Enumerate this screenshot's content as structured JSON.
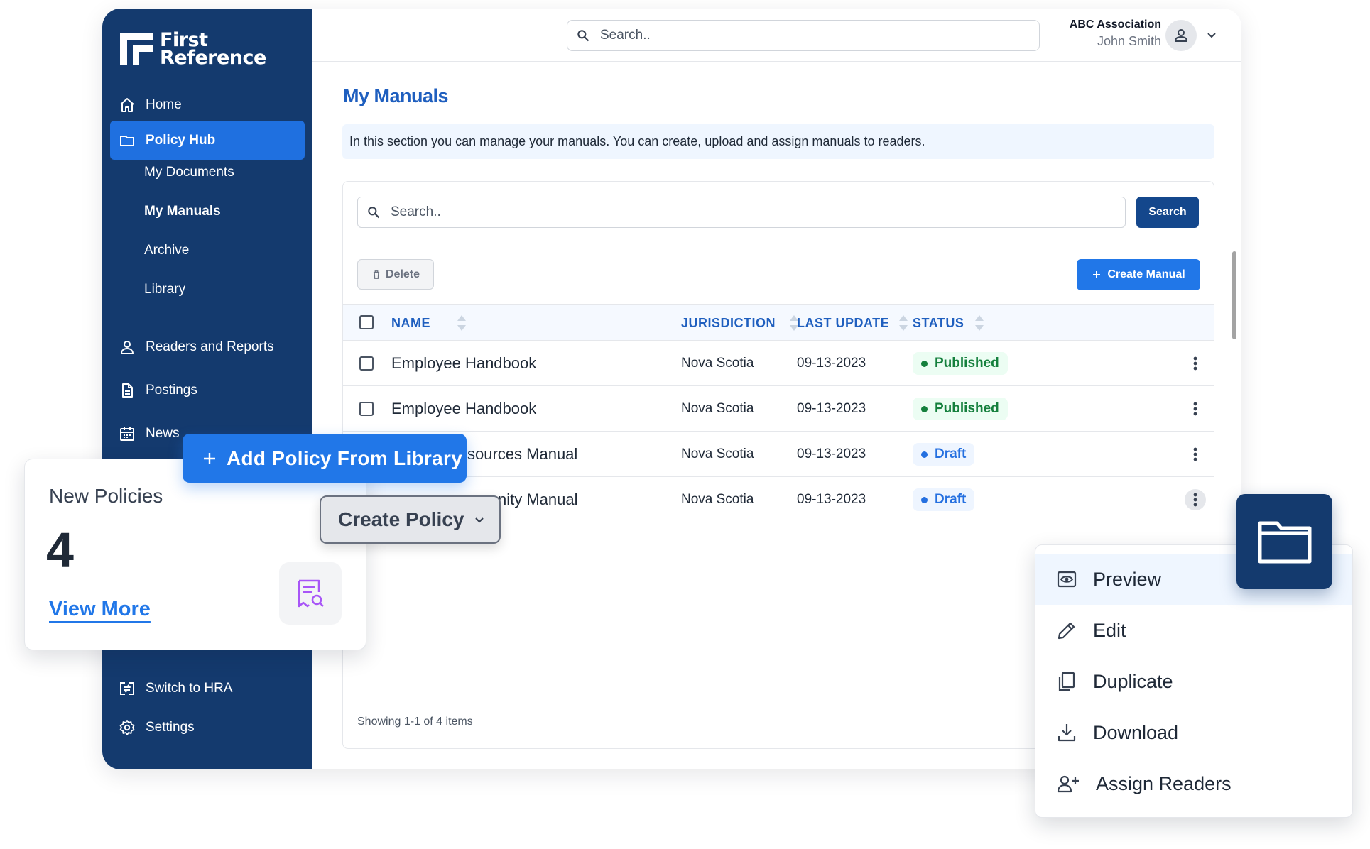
{
  "brand": {
    "line1": "First",
    "line2": "Reference"
  },
  "sidebar": {
    "items": [
      {
        "label": "Home",
        "icon": "home-icon"
      },
      {
        "label": "Policy Hub",
        "icon": "folder-icon",
        "active": true
      },
      {
        "label": "Readers and Reports",
        "icon": "user-icon"
      },
      {
        "label": "Postings",
        "icon": "document-icon"
      },
      {
        "label": "News",
        "icon": "calendar-icon"
      },
      {
        "label": "Switch to HRA",
        "icon": "switch-icon"
      },
      {
        "label": "Settings",
        "icon": "gear-icon"
      }
    ],
    "subitems": [
      {
        "label": "My Documents"
      },
      {
        "label": "My Manuals",
        "current": true
      },
      {
        "label": "Archive"
      },
      {
        "label": "Library"
      }
    ]
  },
  "topbar": {
    "search_placeholder": "Search..",
    "org_name": "ABC Association",
    "user_name": "John Smith"
  },
  "page": {
    "title": "My Manuals",
    "info": "In this section you can manage your manuals. You can create, upload and assign manuals to readers."
  },
  "table_toolbar": {
    "search_placeholder": "Search..",
    "search_button": "Search",
    "delete_button": "Delete",
    "create_button": "Create Manual"
  },
  "table": {
    "columns": [
      "NAME",
      "JURISDICTION",
      "LAST UPDATE",
      "STATUS"
    ],
    "rows": [
      {
        "name": "Employee Handbook",
        "jurisdiction": "Nova Scotia",
        "updated": "09-13-2023",
        "status": "Published"
      },
      {
        "name": "Employee Handbook",
        "jurisdiction": "Nova Scotia",
        "updated": "09-13-2023",
        "status": "Published"
      },
      {
        "name": "sources Manual",
        "jurisdiction": "Nova Scotia",
        "updated": "09-13-2023",
        "status": "Draft"
      },
      {
        "name": "nity Manual",
        "jurisdiction": "Nova Scotia",
        "updated": "09-13-2023",
        "status": "Draft"
      }
    ],
    "footer": "Showing 1-1 of 4 items"
  },
  "new_policies": {
    "title": "New Policies",
    "count": "4",
    "link": "View More"
  },
  "add_policy_button": "Add Policy From Library",
  "create_policy_button": "Create Policy",
  "context_menu": {
    "items": [
      {
        "label": "Preview",
        "icon": "eye-icon"
      },
      {
        "label": "Edit",
        "icon": "pencil-icon"
      },
      {
        "label": "Duplicate",
        "icon": "copy-icon"
      },
      {
        "label": "Download",
        "icon": "download-icon"
      },
      {
        "label": "Assign Readers",
        "icon": "user-plus-icon"
      }
    ]
  },
  "colors": {
    "sidebar": "#143a6e",
    "accent": "#2177e8",
    "published": "#15803d",
    "draft": "#2570e0"
  }
}
